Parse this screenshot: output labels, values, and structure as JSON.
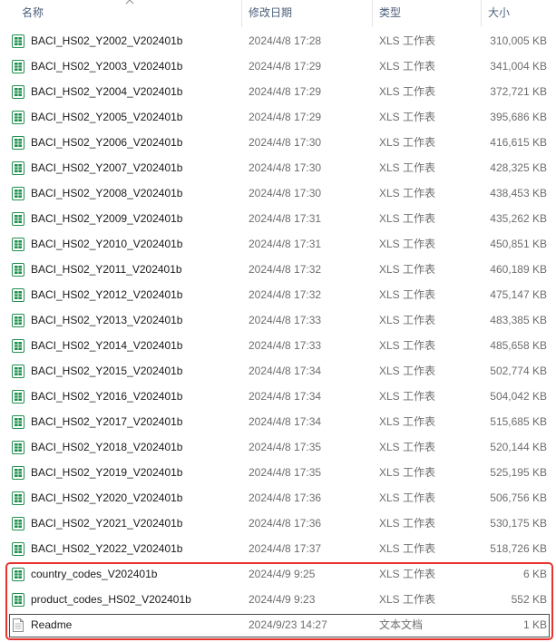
{
  "columns": {
    "name": "名称",
    "date": "修改日期",
    "type": "类型",
    "size": "大小"
  },
  "icons": {
    "xls": "excel-file-icon",
    "txt": "text-file-icon"
  },
  "colors": {
    "highlight": "#e8322d",
    "excel_green": "#1e8f4e"
  },
  "files": [
    {
      "name": "BACI_HS02_Y2002_V202401b",
      "date": "2024/4/8 17:28",
      "type": "XLS 工作表",
      "size": "310,005 KB",
      "icon": "xls"
    },
    {
      "name": "BACI_HS02_Y2003_V202401b",
      "date": "2024/4/8 17:29",
      "type": "XLS 工作表",
      "size": "341,004 KB",
      "icon": "xls"
    },
    {
      "name": "BACI_HS02_Y2004_V202401b",
      "date": "2024/4/8 17:29",
      "type": "XLS 工作表",
      "size": "372,721 KB",
      "icon": "xls"
    },
    {
      "name": "BACI_HS02_Y2005_V202401b",
      "date": "2024/4/8 17:29",
      "type": "XLS 工作表",
      "size": "395,686 KB",
      "icon": "xls"
    },
    {
      "name": "BACI_HS02_Y2006_V202401b",
      "date": "2024/4/8 17:30",
      "type": "XLS 工作表",
      "size": "416,615 KB",
      "icon": "xls"
    },
    {
      "name": "BACI_HS02_Y2007_V202401b",
      "date": "2024/4/8 17:30",
      "type": "XLS 工作表",
      "size": "428,325 KB",
      "icon": "xls"
    },
    {
      "name": "BACI_HS02_Y2008_V202401b",
      "date": "2024/4/8 17:30",
      "type": "XLS 工作表",
      "size": "438,453 KB",
      "icon": "xls"
    },
    {
      "name": "BACI_HS02_Y2009_V202401b",
      "date": "2024/4/8 17:31",
      "type": "XLS 工作表",
      "size": "435,262 KB",
      "icon": "xls"
    },
    {
      "name": "BACI_HS02_Y2010_V202401b",
      "date": "2024/4/8 17:31",
      "type": "XLS 工作表",
      "size": "450,851 KB",
      "icon": "xls"
    },
    {
      "name": "BACI_HS02_Y2011_V202401b",
      "date": "2024/4/8 17:32",
      "type": "XLS 工作表",
      "size": "460,189 KB",
      "icon": "xls"
    },
    {
      "name": "BACI_HS02_Y2012_V202401b",
      "date": "2024/4/8 17:32",
      "type": "XLS 工作表",
      "size": "475,147 KB",
      "icon": "xls"
    },
    {
      "name": "BACI_HS02_Y2013_V202401b",
      "date": "2024/4/8 17:33",
      "type": "XLS 工作表",
      "size": "483,385 KB",
      "icon": "xls"
    },
    {
      "name": "BACI_HS02_Y2014_V202401b",
      "date": "2024/4/8 17:33",
      "type": "XLS 工作表",
      "size": "485,658 KB",
      "icon": "xls"
    },
    {
      "name": "BACI_HS02_Y2015_V202401b",
      "date": "2024/4/8 17:34",
      "type": "XLS 工作表",
      "size": "502,774 KB",
      "icon": "xls"
    },
    {
      "name": "BACI_HS02_Y2016_V202401b",
      "date": "2024/4/8 17:34",
      "type": "XLS 工作表",
      "size": "504,042 KB",
      "icon": "xls"
    },
    {
      "name": "BACI_HS02_Y2017_V202401b",
      "date": "2024/4/8 17:34",
      "type": "XLS 工作表",
      "size": "515,685 KB",
      "icon": "xls"
    },
    {
      "name": "BACI_HS02_Y2018_V202401b",
      "date": "2024/4/8 17:35",
      "type": "XLS 工作表",
      "size": "520,144 KB",
      "icon": "xls"
    },
    {
      "name": "BACI_HS02_Y2019_V202401b",
      "date": "2024/4/8 17:35",
      "type": "XLS 工作表",
      "size": "525,195 KB",
      "icon": "xls"
    },
    {
      "name": "BACI_HS02_Y2020_V202401b",
      "date": "2024/4/8 17:36",
      "type": "XLS 工作表",
      "size": "506,756 KB",
      "icon": "xls"
    },
    {
      "name": "BACI_HS02_Y2021_V202401b",
      "date": "2024/4/8 17:36",
      "type": "XLS 工作表",
      "size": "530,175 KB",
      "icon": "xls"
    },
    {
      "name": "BACI_HS02_Y2022_V202401b",
      "date": "2024/4/8 17:37",
      "type": "XLS 工作表",
      "size": "518,726 KB",
      "icon": "xls"
    },
    {
      "name": "country_codes_V202401b",
      "date": "2024/4/9 9:25",
      "type": "XLS 工作表",
      "size": "6 KB",
      "icon": "xls"
    },
    {
      "name": "product_codes_HS02_V202401b",
      "date": "2024/4/9 9:23",
      "type": "XLS 工作表",
      "size": "552 KB",
      "icon": "xls"
    },
    {
      "name": "Readme",
      "date": "2024/9/23 14:27",
      "type": "文本文档",
      "size": "1 KB",
      "icon": "txt"
    }
  ]
}
